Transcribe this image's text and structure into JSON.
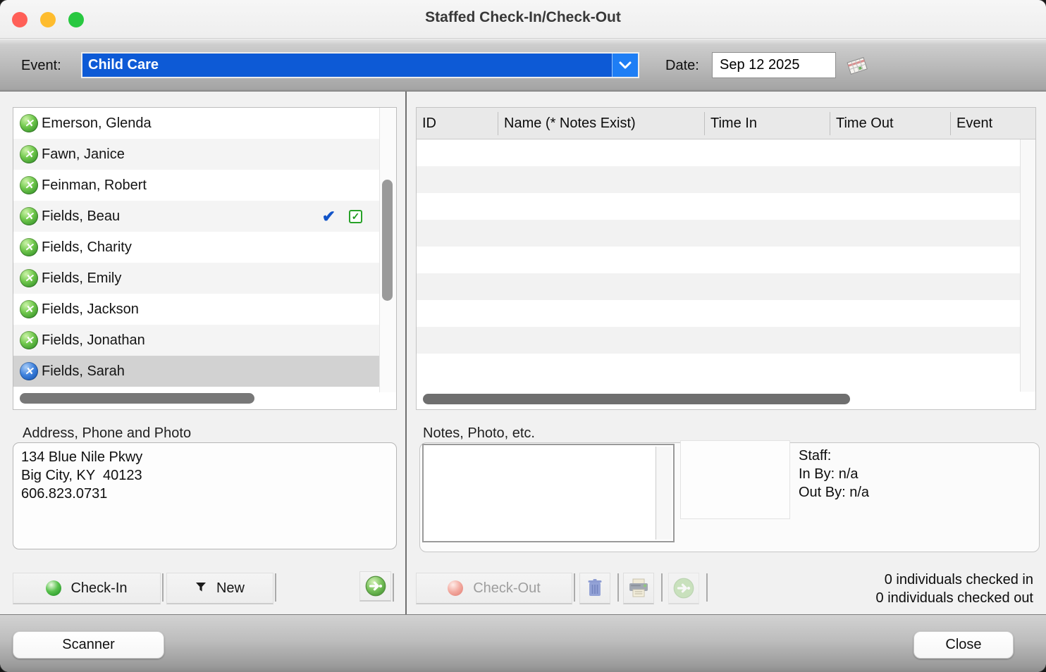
{
  "window": {
    "title": "Staffed Check-In/Check-Out"
  },
  "toolbar": {
    "event_label": "Event:",
    "event_value": "Child Care",
    "date_label": "Date:",
    "date_value": "Sep 12 2025"
  },
  "roster": {
    "items": [
      {
        "name": "Emerson, Glenda",
        "status_icon": "green-x"
      },
      {
        "name": "Fawn, Janice",
        "status_icon": "green-x"
      },
      {
        "name": "Feinman, Robert",
        "status_icon": "green-x"
      },
      {
        "name": "Fields, Beau",
        "status_icon": "green-x",
        "checked_in_markers": true
      },
      {
        "name": "Fields, Charity",
        "status_icon": "green-x"
      },
      {
        "name": "Fields, Emily",
        "status_icon": "green-x"
      },
      {
        "name": "Fields, Jackson",
        "status_icon": "green-x"
      },
      {
        "name": "Fields, Jonathan",
        "status_icon": "green-x"
      },
      {
        "name": "Fields, Sarah",
        "status_icon": "blue-x",
        "selected": true
      }
    ]
  },
  "detail_table": {
    "columns": [
      "ID",
      "Name (* Notes Exist)",
      "Time In",
      "Time Out",
      "Event"
    ],
    "rows": []
  },
  "address": {
    "label": "Address, Phone and Photo",
    "line1": "134 Blue Nile Pkwy",
    "line2": "Big City, KY  40123",
    "line3": "606.823.0731"
  },
  "notes": {
    "label": "Notes, Photo, etc.",
    "notes_value": "",
    "staff": {
      "line1": "Staff:",
      "line2": "In By: n/a",
      "line3": "Out By: n/a"
    }
  },
  "buttons": {
    "check_in": "Check-In",
    "new": "New",
    "check_out": "Check-Out",
    "scanner": "Scanner",
    "close": "Close"
  },
  "status": {
    "checked_in": "0 individuals checked in",
    "checked_out": "0 individuals checked out"
  },
  "glyphs": {
    "x_mark": "✕",
    "check_mark": "✔",
    "box_check": "✓"
  },
  "colors": {
    "combo_blue": "#0d5ad6",
    "combo_button_blue": "#1e7ef5",
    "status_green": "#3f9b2f",
    "status_blue": "#1c5cb8",
    "selected_row": "#d2d2d2",
    "traffic_red": "#ff5f57",
    "traffic_yellow": "#febc2e",
    "traffic_green": "#28c840"
  }
}
